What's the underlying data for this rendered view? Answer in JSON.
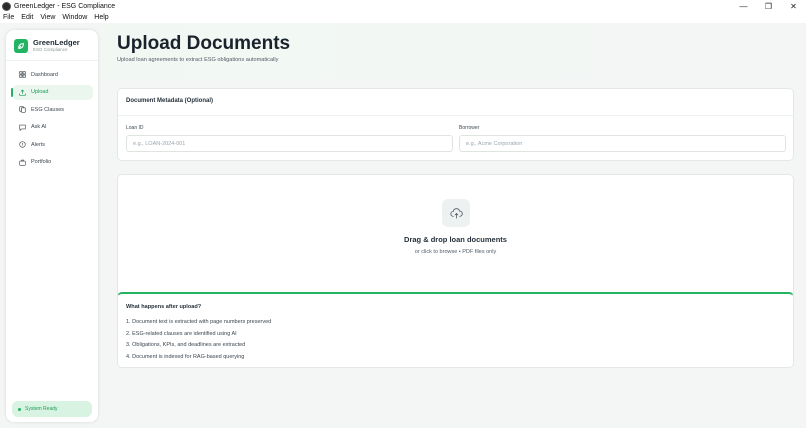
{
  "window": {
    "title": "GreenLedger - ESG Compliance",
    "controls": {
      "minimize": "—",
      "restore": "❐",
      "close": "✕"
    }
  },
  "menu": [
    "File",
    "Edit",
    "View",
    "Window",
    "Help"
  ],
  "sidebar": {
    "brand_name": "GreenLedger",
    "brand_sub": "ESG Compliance",
    "items": [
      {
        "label": "Dashboard",
        "icon": "dashboard-icon",
        "active": false
      },
      {
        "label": "Upload",
        "icon": "upload-icon",
        "active": true
      },
      {
        "label": "ESG Clauses",
        "icon": "clauses-icon",
        "active": false
      },
      {
        "label": "Ask AI",
        "icon": "chat-icon",
        "active": false
      },
      {
        "label": "Alerts",
        "icon": "alert-icon",
        "active": false
      },
      {
        "label": "Portfolio",
        "icon": "briefcase-icon",
        "active": false
      }
    ],
    "status": "System Ready"
  },
  "header": {
    "title": "Upload Documents",
    "subtitle": "Upload loan agreements to extract ESG obligations automatically"
  },
  "metadata": {
    "title": "Document Metadata (Optional)",
    "loan_id_label": "Loan ID",
    "loan_id_placeholder": "e.g., LOAN-2024-001",
    "borrower_label": "Borrower",
    "borrower_placeholder": "e.g., Acme Corporation"
  },
  "dropzone": {
    "title": "Drag & drop loan documents",
    "subtitle": "or click to browse • PDF files only"
  },
  "info": {
    "title": "What happens after upload?",
    "steps": [
      "1. Document text is extracted with page numbers preserved",
      "2. ESG-related clauses are identified using AI",
      "3. Obligations, KPIs, and deadlines are extracted",
      "4. Document is indexed for RAG-based querying"
    ]
  },
  "colors": {
    "accent": "#22b463",
    "accent_light": "#eaf6ee",
    "text": "#1f2933"
  }
}
